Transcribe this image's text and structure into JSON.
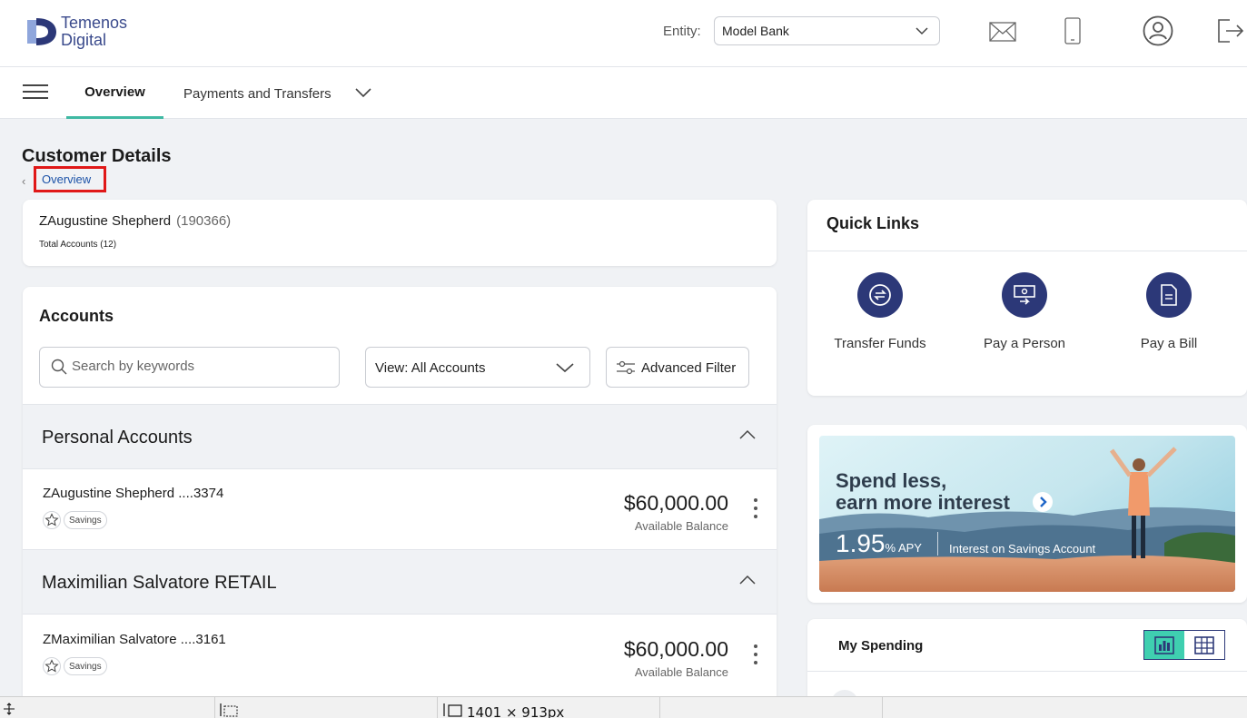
{
  "header": {
    "logo": {
      "line1": "Temenos",
      "line2": "Digital",
      "colors": {
        "dark": "#2c3878",
        "light": "#8fa6dc"
      }
    },
    "entity_label": "Entity:",
    "entity_value": "Model Bank",
    "icons": [
      "mail-icon",
      "mobile-icon",
      "profile-icon",
      "logout-icon"
    ]
  },
  "nav": {
    "tabs": [
      {
        "label": "Overview",
        "active": true
      },
      {
        "label": "Payments and Transfers",
        "active": false
      }
    ],
    "accent": "#3fb9a3"
  },
  "page": {
    "title": "Customer Details",
    "breadcrumb": "Overview"
  },
  "customer": {
    "name": "ZAugustine Shepherd",
    "id": "(190366)",
    "total_accounts": "Total Accounts (12)"
  },
  "accounts": {
    "title": "Accounts",
    "search_placeholder": "Search by keywords",
    "view_label": "View:  All Accounts",
    "filter_label": "Advanced Filter",
    "groups": [
      {
        "title": "Personal Accounts",
        "rows": [
          {
            "name": "ZAugustine Shepherd ....3374",
            "type": "Savings",
            "balance": "$60,000.00",
            "balance_label": "Available Balance"
          }
        ]
      },
      {
        "title": "Maximilian Salvatore RETAIL",
        "rows": [
          {
            "name": "ZMaximilian Salvatore ....3161",
            "type": "Savings",
            "balance": "$60,000.00",
            "balance_label": "Available Balance"
          }
        ]
      }
    ]
  },
  "quick_links": {
    "title": "Quick Links",
    "items": [
      {
        "label": "Transfer Funds",
        "icon": "transfer-icon"
      },
      {
        "label": "Pay a Person",
        "icon": "pay-person-icon"
      },
      {
        "label": "Pay a Bill",
        "icon": "bill-icon"
      }
    ],
    "icon_bg": "#2c3878"
  },
  "promo": {
    "line1": "Spend less,",
    "line2": "earn more interest",
    "rate": "1.95",
    "rate_unit": "% APY",
    "note": "Interest on Savings Account"
  },
  "spending": {
    "title": "My Spending",
    "toggle_colors": {
      "active": "#3fcfb0",
      "border": "#2c3878"
    }
  },
  "statusbar": {
    "dimensions": "1401 × 913px"
  }
}
